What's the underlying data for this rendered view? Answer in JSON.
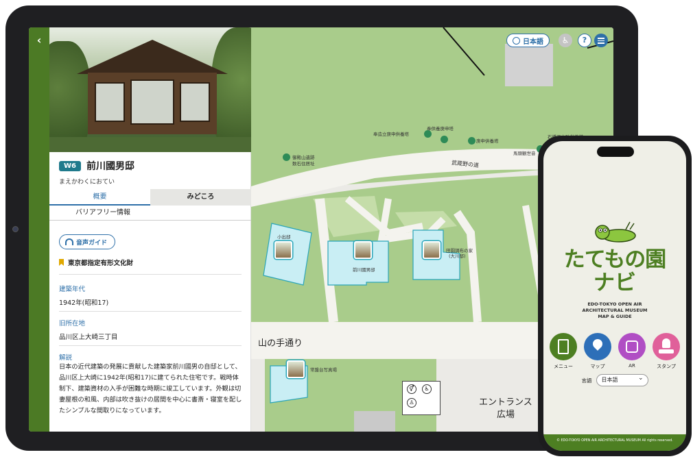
{
  "tablet": {
    "panel": {
      "code": "W6",
      "name": "前川國男邸",
      "reading": "まえかわくにおてい",
      "tabs": [
        "概要",
        "みどころ"
      ],
      "tab_row2": "バリアフリー情報",
      "audio_guide": "音声ガイド",
      "designation": "東京都指定有形文化財",
      "sections": [
        {
          "label": "建築年代",
          "value": "1942年(昭和17)"
        },
        {
          "label": "旧所在地",
          "value": "品川区上大崎三丁目"
        }
      ],
      "desc_label": "解説",
      "description": "日本の近代建築の発展に貢献した建築家前川國男の自邸として、品川区上大崎に1942年(昭和17)に建てられた住宅です。戦時体制下、建築資材の入手が困難な時期に竣工しています。外観は切妻屋根の和風、内部は吹き抜けの居間を中心に書斎・寝室を配したシンプルな間取りになっています。"
    },
    "map": {
      "lang_button": "日本語",
      "labels": {
        "road": "武蔵野の道",
        "poi1": "奉供養庚申塔",
        "poi2": "庚申供養塔",
        "poi3": "奉造立庚申供養塔",
        "poi4": "石橋三之助供養塔",
        "poi5": "馬頭観世音",
        "poi6_line1": "御殿山遺跡",
        "poi6_line2": "数石住居址",
        "b1": "小出邸",
        "b2": "前川國男邸",
        "b3_line1": "田園調布の家",
        "b3_line2": "(大川邸)",
        "street": "山の手通り",
        "b4": "常盤台写真場",
        "plaza_line1": "エントランス",
        "plaza_line2": "広場"
      }
    }
  },
  "phone": {
    "title_line1": "たてもの園",
    "title_line2": "ナビ",
    "subtitle": [
      "EDO-TOKYO OPEN AIR",
      "ARCHITECTURAL MUSEUM",
      "MAP & GUIDE"
    ],
    "menu": [
      {
        "label": "メニュー",
        "color": "#4d7f22"
      },
      {
        "label": "マップ",
        "color": "#2d6fb8"
      },
      {
        "label": "AR",
        "color": "#b04ec4"
      },
      {
        "label": "スタンプ",
        "color": "#e0609a"
      }
    ],
    "lang_label": "言語",
    "lang_value": "日本語",
    "footer": "© EDO-TOKYO OPEN AIR ARCHITECTURAL MUSEUM All rights reserved."
  }
}
